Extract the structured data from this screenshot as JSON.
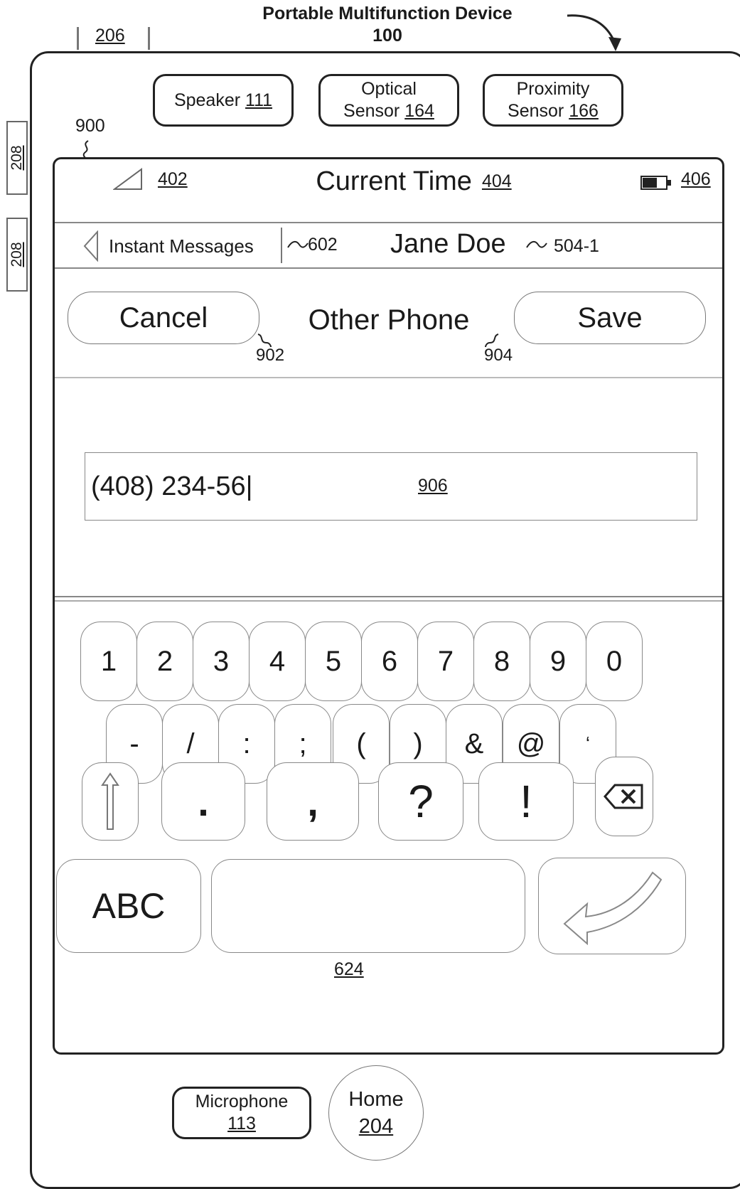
{
  "device_title": "Portable Multifunction Device",
  "device_number": "100",
  "ref_206": "206",
  "ref_208_a": "208",
  "ref_208_b": "208",
  "ref_900": "900",
  "sensors": {
    "speaker": {
      "label": "Speaker",
      "ref": "111"
    },
    "optical": {
      "label": "Optical",
      "label2": "Sensor",
      "ref": "164"
    },
    "proximity": {
      "label": "Proximity",
      "label2": "Sensor",
      "ref": "166"
    }
  },
  "status_bar": {
    "signal_ref": "402",
    "time_label": "Current Time",
    "time_ref": "404",
    "battery_ref": "406"
  },
  "nav_bar": {
    "back_label": "Instant Messages",
    "back_ref": "602",
    "contact_name": "Jane Doe",
    "contact_ref": "504-1"
  },
  "editor": {
    "cancel_label": "Cancel",
    "cancel_ref": "902",
    "title": "Other Phone",
    "save_label": "Save",
    "save_ref": "904",
    "field_value": "(408) 234-56",
    "field_ref": "906"
  },
  "keyboard": {
    "row1": [
      "1",
      "2",
      "3",
      "4",
      "5",
      "6",
      "7",
      "8",
      "9",
      "0"
    ],
    "row2": [
      "-",
      "/",
      ":",
      ";",
      "(",
      ")",
      "&",
      "@",
      "‘"
    ],
    "row3": [
      ".",
      ",",
      "?",
      "!"
    ],
    "abc_label": "ABC",
    "ref": "624",
    "icons": [
      "shift-icon",
      "backspace-icon",
      "return-icon"
    ]
  },
  "bottom": {
    "microphone_label": "Microphone",
    "microphone_ref": "113",
    "home_label": "Home",
    "home_ref": "204"
  }
}
